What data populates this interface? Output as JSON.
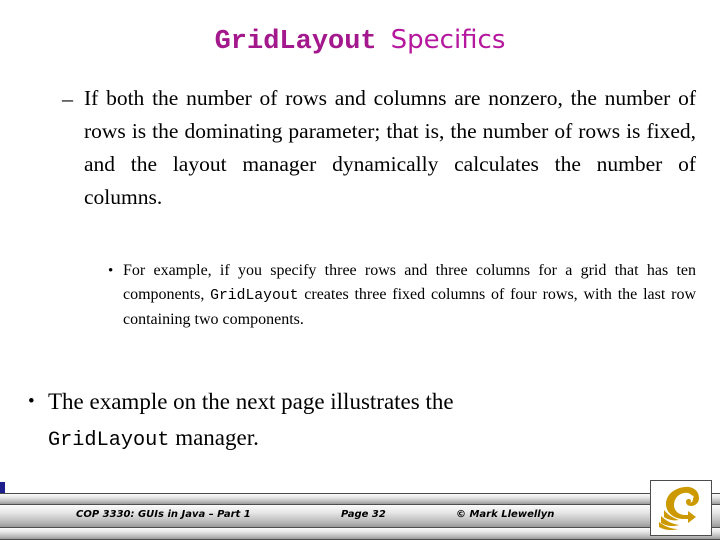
{
  "slide": {
    "title": {
      "mono_part": "GridLayout",
      "sans_part": "Specifics"
    },
    "bullets": [
      {
        "level": 1,
        "marker": "–",
        "text_before": "If both the number of rows and columns are nonzero, the number of rows is the dominating parameter; that is, the number of rows is fixed, and the layout manager dynamically calculates the number of columns."
      },
      {
        "level": 2,
        "marker": "•",
        "text_before": "For example, if you specify three rows and three columns for a grid that has ten components, ",
        "code": "GridLayout",
        "text_after": " creates three fixed columns of four rows, with the last row containing two components."
      },
      {
        "level": 1,
        "marker": "•",
        "line1": "The example on the next page illustrates the",
        "code": "GridLayout",
        "text_after": " manager."
      }
    ],
    "footer": {
      "course": "COP 3330:  GUIs in Java – Part 1",
      "page": "Page 32",
      "copyright": "© Mark Llewellyn"
    },
    "colors": {
      "title_mono": "#a3188c",
      "title_sans": "#b5189e",
      "logo_gold": "#cc9900",
      "accent_blue": "#1f1f8c"
    }
  }
}
